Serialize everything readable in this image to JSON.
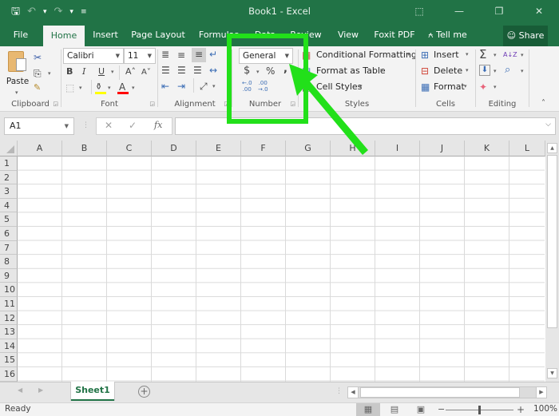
{
  "window": {
    "title": "Book1  -  Excel",
    "quick_access": {
      "save_icon": "save-icon",
      "undo_icon": "undo-icon",
      "redo_icon": "redo-icon",
      "customize_icon": "customize-qat-icon"
    },
    "controls": {
      "ribbon_display": "⬚",
      "minimize": "—",
      "restore": "❐",
      "close": "✕"
    }
  },
  "tabs": [
    {
      "label": "File"
    },
    {
      "label": "Home",
      "active": true
    },
    {
      "label": "Insert"
    },
    {
      "label": "Page Layout"
    },
    {
      "label": "Formulas"
    },
    {
      "label": "Data"
    },
    {
      "label": "Review"
    },
    {
      "label": "View"
    },
    {
      "label": "Foxit PDF"
    }
  ],
  "tell_me": {
    "icon": "⍲",
    "label": "Tell me"
  },
  "share": {
    "icon": "☺",
    "label": "Share"
  },
  "ribbon": {
    "clipboard": {
      "label": "Clipboard",
      "paste": "Paste",
      "cut_icon": "✂",
      "copy_icon": "⎘",
      "painter_icon": "🖌"
    },
    "font": {
      "label": "Font",
      "font_name": "Calibri",
      "font_size": "11",
      "bold": "B",
      "italic": "I",
      "underline": "U",
      "grow": "A˄",
      "shrink": "A˅",
      "fill_color": "#ffff00",
      "font_color": "#ff0000"
    },
    "alignment": {
      "label": "Alignment"
    },
    "number": {
      "label": "Number",
      "format": "General",
      "currency": "$",
      "percent": "%",
      "comma": ",",
      "inc_decimal": "←.0\n.00",
      "dec_decimal": ".00\n→.0"
    },
    "styles": {
      "label": "Styles",
      "conditional": "Conditional Formatting",
      "format_table": "Format as Table",
      "cell_styles": "Cell Styles"
    },
    "cells": {
      "label": "Cells",
      "insert": "Insert",
      "delete": "Delete",
      "format": "Format"
    },
    "editing": {
      "label": "Editing",
      "autosum": "Σ",
      "sort": "A↓Z",
      "fill": "⬇",
      "find": "⌕",
      "clear": "✦"
    },
    "collapse": "˄"
  },
  "formula_bar": {
    "name_box": "A1",
    "cancel": "✕",
    "enter": "✓",
    "fx": "fx",
    "value": ""
  },
  "grid": {
    "columns": [
      "A",
      "B",
      "C",
      "D",
      "E",
      "F",
      "G",
      "H",
      "I",
      "J",
      "K",
      "L"
    ],
    "rows": [
      "1",
      "2",
      "3",
      "4",
      "5",
      "6",
      "7",
      "8",
      "9",
      "10",
      "11",
      "12",
      "13",
      "14",
      "15",
      "16"
    ]
  },
  "sheets": [
    {
      "label": "Sheet1",
      "active": true
    }
  ],
  "add_sheet": "+",
  "status": {
    "text": "Ready",
    "zoom": "100%",
    "zoom_minus": "−",
    "zoom_plus": "+",
    "views": [
      "▦",
      "▤",
      "▣"
    ]
  },
  "annotation": {
    "color": "#22e01a",
    "target": "Number group / number format dropdown"
  }
}
